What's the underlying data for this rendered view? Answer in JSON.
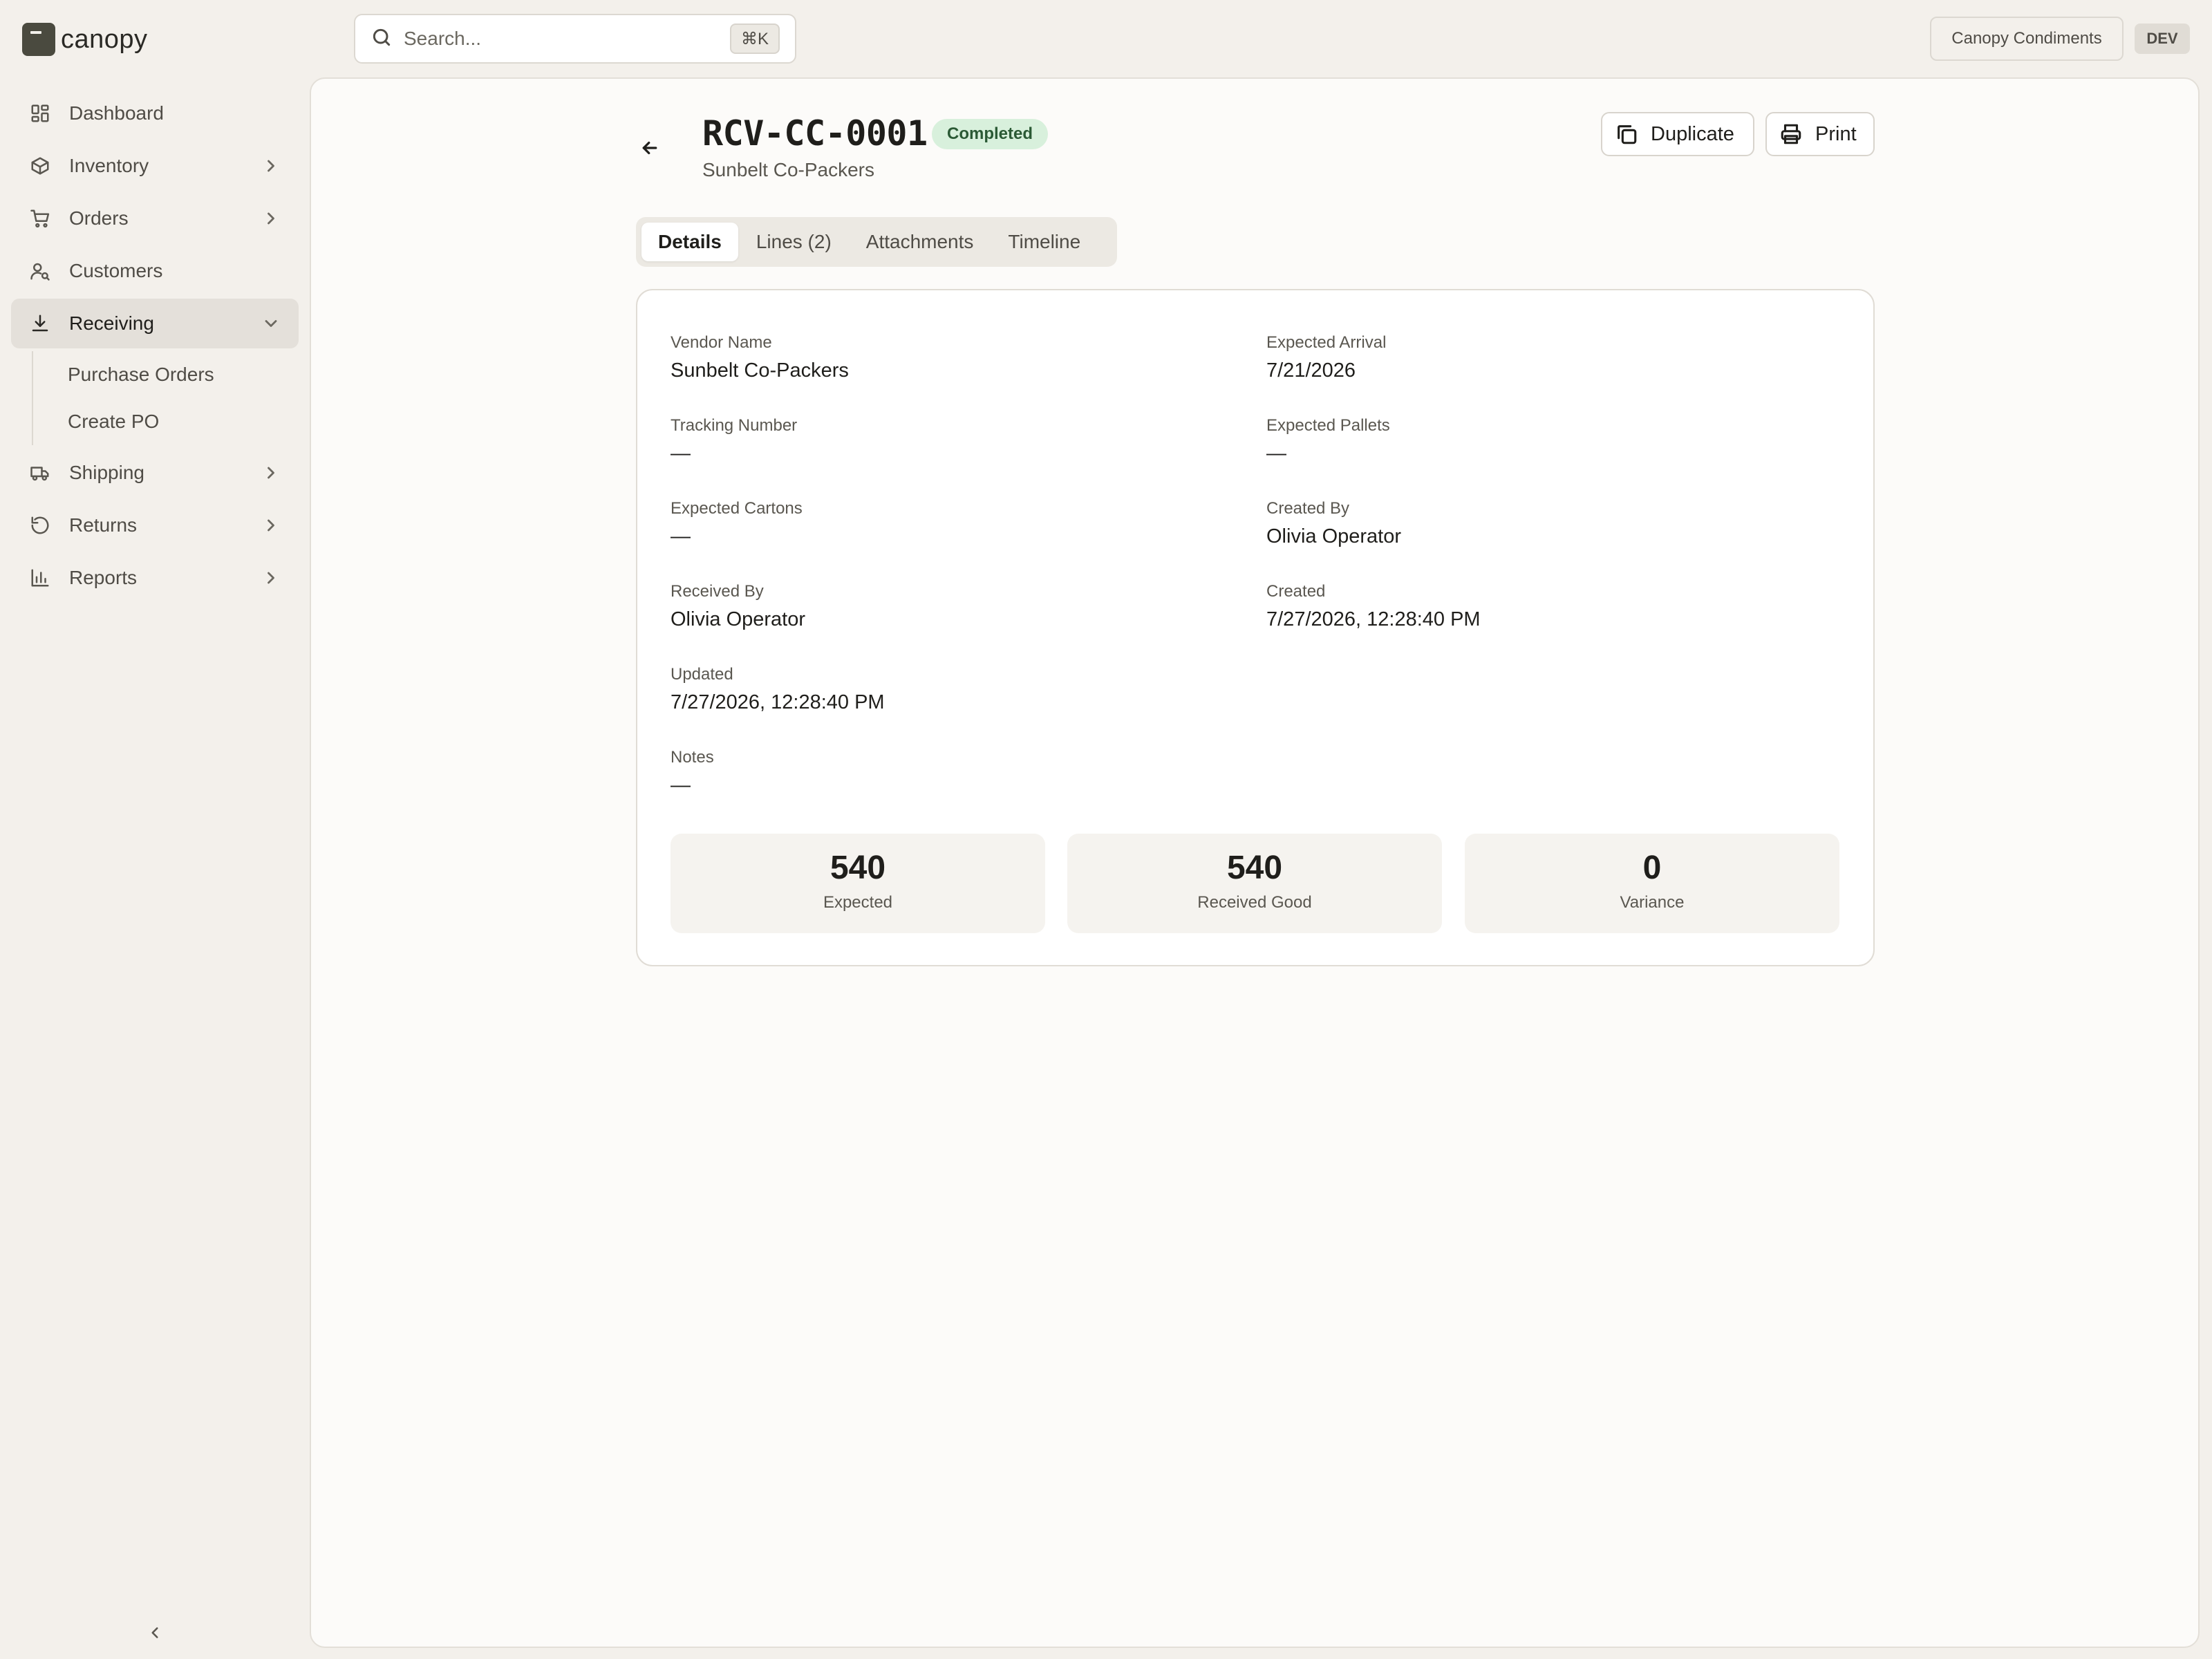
{
  "app": {
    "logo_text": "canopy"
  },
  "sidebar": {
    "items": [
      {
        "label": "Dashboard",
        "icon": "dashboard-icon"
      },
      {
        "label": "Inventory",
        "icon": "box-icon"
      },
      {
        "label": "Orders",
        "icon": "cart-icon"
      },
      {
        "label": "Customers",
        "icon": "user-search-icon"
      },
      {
        "label": "Receiving",
        "icon": "download-icon",
        "active": true,
        "children": [
          {
            "label": "Purchase Orders"
          },
          {
            "label": "Create PO"
          }
        ]
      },
      {
        "label": "Shipping",
        "icon": "truck-icon"
      },
      {
        "label": "Returns",
        "icon": "rotate-icon"
      },
      {
        "label": "Reports",
        "icon": "bar-chart-icon"
      }
    ]
  },
  "header": {
    "search_placeholder": "Search...",
    "search_shortcut": "⌘K",
    "org_name": "Canopy Condiments",
    "env_badge": "DEV"
  },
  "page": {
    "title": "RCV-CC-0001",
    "status": "Completed",
    "subtitle": "Sunbelt Co-Packers",
    "actions": {
      "duplicate": "Duplicate",
      "print": "Print"
    },
    "tabs": [
      {
        "label": "Details",
        "active": true
      },
      {
        "label": "Lines (2)"
      },
      {
        "label": "Attachments"
      },
      {
        "label": "Timeline"
      }
    ]
  },
  "details": {
    "vendor_name": {
      "label": "Vendor Name",
      "value": "Sunbelt Co-Packers"
    },
    "expected_arrival": {
      "label": "Expected Arrival",
      "value": "7/21/2026"
    },
    "tracking_number": {
      "label": "Tracking Number",
      "value": "—"
    },
    "expected_pallets": {
      "label": "Expected Pallets",
      "value": "—"
    },
    "expected_cartons": {
      "label": "Expected Cartons",
      "value": "—"
    },
    "created_by": {
      "label": "Created By",
      "value": "Olivia Operator"
    },
    "received_by": {
      "label": "Received By",
      "value": "Olivia Operator"
    },
    "created": {
      "label": "Created",
      "value": "7/27/2026, 12:28:40 PM"
    },
    "updated": {
      "label": "Updated",
      "value": "7/27/2026, 12:28:40 PM"
    },
    "notes": {
      "label": "Notes",
      "value": "—"
    }
  },
  "stats": [
    {
      "value": "540",
      "label": "Expected"
    },
    {
      "value": "540",
      "label": "Received Good"
    },
    {
      "value": "0",
      "label": "Variance"
    }
  ],
  "colors": {
    "background": "#f3f0eb",
    "panel": "#fcfbf9",
    "status_badge_bg": "#d8f0dc",
    "status_badge_text": "#2b5a35",
    "active_nav": "#e4e0da"
  }
}
